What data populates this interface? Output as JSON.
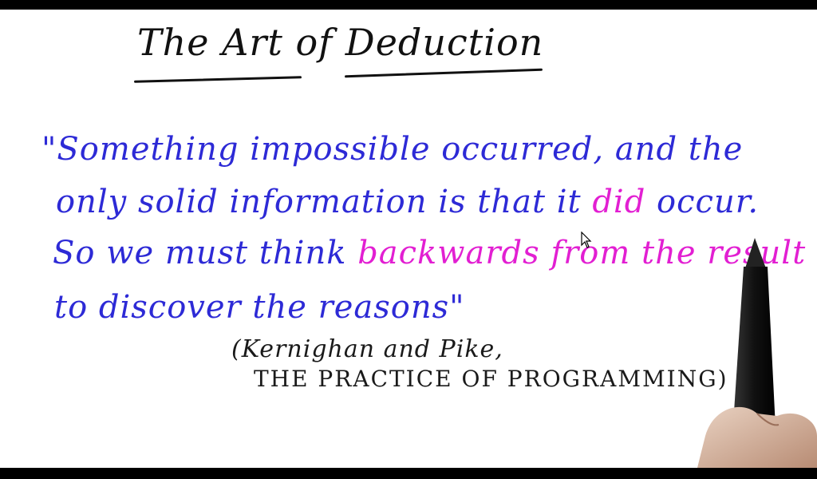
{
  "title": "The Art of Deduction",
  "quote": {
    "line1": "\"Something impossible occurred, and the",
    "line2_a": "only solid information is that it ",
    "line2_b": "did",
    "line2_c": " occur.",
    "line3_a": "So we must think ",
    "line3_b": "backwards from the result",
    "line4": "to discover the reasons\""
  },
  "citation": {
    "line1": "(Kernighan and Pike,",
    "line2": "THE PRACTICE OF PROGRAMMING)"
  },
  "colors": {
    "quote": "#2d2ad6",
    "emphasis": "#e21fd2",
    "ink": "#111111"
  },
  "icons": [
    "mouse-cursor-icon",
    "pen-icon"
  ]
}
